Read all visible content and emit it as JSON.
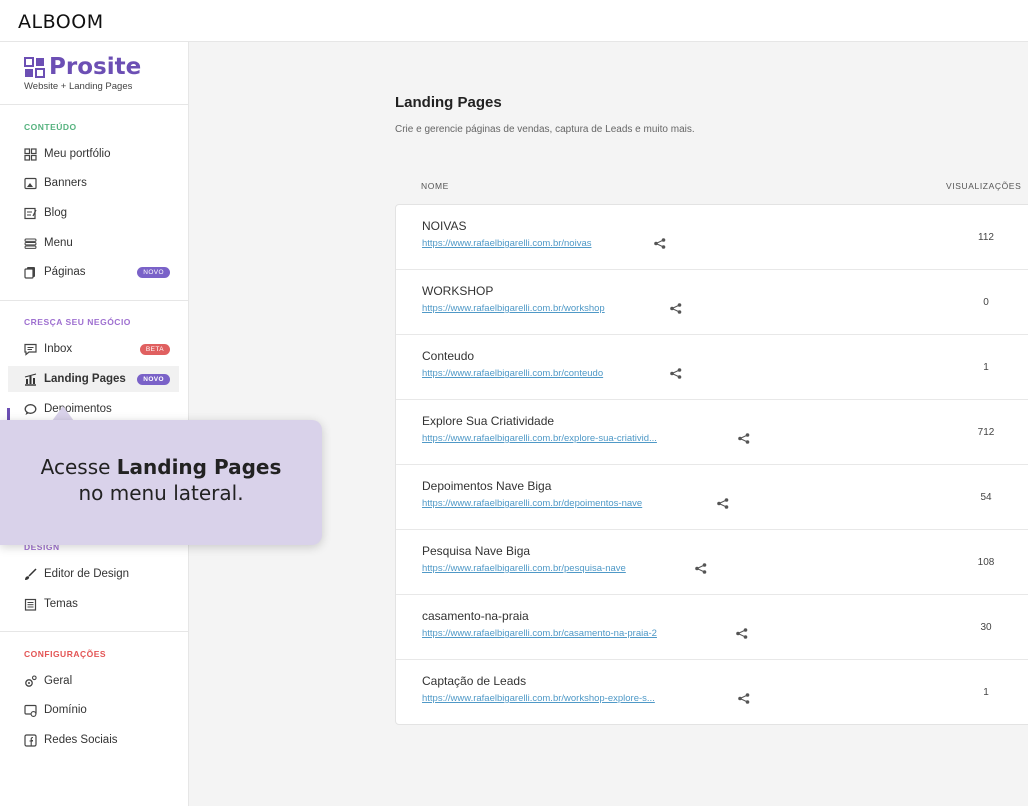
{
  "topbar": {
    "logo": "ALBOOM"
  },
  "brand": {
    "name": "Prosite",
    "subtitle": "Website + Landing Pages"
  },
  "sidebar": {
    "sections": [
      {
        "label": "CONTEÚDO",
        "items": [
          {
            "label": "Meu portfólio",
            "icon": "portfolio-icon"
          },
          {
            "label": "Banners",
            "icon": "image-icon"
          },
          {
            "label": "Blog",
            "icon": "blog-icon"
          },
          {
            "label": "Menu",
            "icon": "menu-icon"
          },
          {
            "label": "Páginas",
            "icon": "pages-icon",
            "badge": "NOVO"
          }
        ]
      },
      {
        "label": "CRESÇA SEU NEGÓCIO",
        "items": [
          {
            "label": "Inbox",
            "icon": "inbox-icon",
            "badge": "BETA"
          },
          {
            "label": "Landing Pages",
            "icon": "landing-icon",
            "badge": "NOVO",
            "active": true
          },
          {
            "label": "Depoimentos",
            "icon": "chat-icon"
          }
        ]
      },
      {
        "label": "DESIGN",
        "items": [
          {
            "label": "Editor de Design",
            "icon": "brush-icon"
          },
          {
            "label": "Temas",
            "icon": "themes-icon"
          }
        ]
      },
      {
        "label": "CONFIGURAÇÕES",
        "items": [
          {
            "label": "Geral",
            "icon": "gear-icon"
          },
          {
            "label": "Domínio",
            "icon": "domain-icon"
          },
          {
            "label": "Redes Sociais",
            "icon": "social-icon"
          }
        ]
      }
    ]
  },
  "tooltip": {
    "prefix": "Acesse ",
    "bold": "Landing Pages",
    "line2": "no menu lateral."
  },
  "main": {
    "title": "Landing Pages",
    "subtitle": "Crie e gerencie páginas de vendas, captura de Leads e muito mais.",
    "columns": {
      "name": "NOME",
      "views": "VISUALIZAÇÕES"
    },
    "rows": [
      {
        "name": "NOIVAS",
        "url": "https://www.rafaelbigarelli.com.br/noivas",
        "views": "112"
      },
      {
        "name": "WORKSHOP",
        "url": "https://www.rafaelbigarelli.com.br/workshop",
        "views": "0"
      },
      {
        "name": "Conteudo",
        "url": "https://www.rafaelbigarelli.com.br/conteudo",
        "views": "1"
      },
      {
        "name": "Explore Sua Criatividade",
        "url": "https://www.rafaelbigarelli.com.br/explore-sua-criativid...",
        "views": "712"
      },
      {
        "name": "Depoimentos Nave Biga",
        "url": "https://www.rafaelbigarelli.com.br/depoimentos-nave",
        "views": "54"
      },
      {
        "name": "Pesquisa Nave Biga",
        "url": "https://www.rafaelbigarelli.com.br/pesquisa-nave",
        "views": "108"
      },
      {
        "name": "casamento-na-praia",
        "url": "https://www.rafaelbigarelli.com.br/casamento-na-praia-2",
        "views": "30"
      },
      {
        "name": "Captação de Leads",
        "url": "https://www.rafaelbigarelli.com.br/workshop-explore-s...",
        "views": "1"
      }
    ]
  },
  "colors": {
    "brand": "#6c4fb4",
    "link": "#4f99c7",
    "tooltip": "#d9d2ea"
  }
}
